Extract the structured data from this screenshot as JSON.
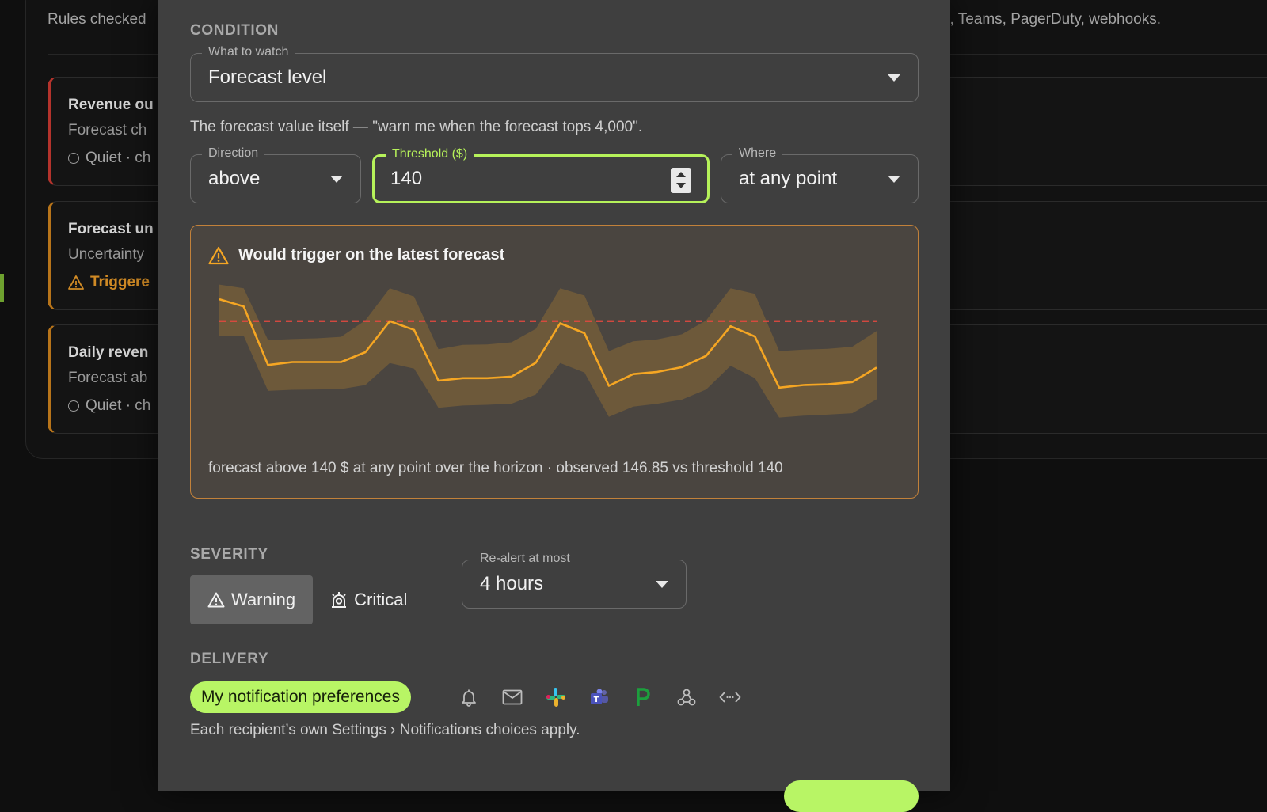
{
  "background": {
    "intro_left": "Rules checked",
    "intro_right": "k, Teams, PagerDuty, webhooks.",
    "rules": [
      {
        "title": "Revenue ou",
        "subtitle": "Forecast ch",
        "status": "Quiet · ch",
        "state": "quiet",
        "accent": "#b4332c"
      },
      {
        "title": "Forecast un",
        "subtitle": "Uncertainty",
        "status": "Triggere",
        "state": "triggered",
        "accent": "#b7741a"
      },
      {
        "title": "Daily reven",
        "subtitle": "Forecast ab",
        "status": "Quiet · ch",
        "state": "quiet",
        "accent": "#b7741a"
      }
    ]
  },
  "modal": {
    "condition": {
      "section_label": "CONDITION",
      "watch": {
        "label": "What to watch",
        "value": "Forecast level"
      },
      "helper": "The forecast value itself — \"warn me when the forecast tops 4,000\".",
      "direction": {
        "label": "Direction",
        "value": "above"
      },
      "threshold": {
        "label": "Threshold ($)",
        "value": "140"
      },
      "where": {
        "label": "Where",
        "value": "at any point"
      }
    },
    "preview": {
      "title": "Would trigger on the latest forecast",
      "caption": "forecast above 140 $ at any point over the horizon · observed 146.85 vs threshold 140"
    },
    "severity": {
      "section_label": "SEVERITY",
      "options": [
        {
          "label": "Warning",
          "icon": "warning-triangle-icon",
          "selected": true
        },
        {
          "label": "Critical",
          "icon": "critical-alarm-icon",
          "selected": false
        }
      ],
      "realert": {
        "label": "Re-alert at most",
        "value": "4 hours"
      }
    },
    "delivery": {
      "section_label": "DELIVERY",
      "pill_label": "My notification preferences",
      "channels": [
        "bell-icon",
        "email-icon",
        "slack-icon",
        "teams-icon",
        "pagerduty-icon",
        "webhook-icon",
        "code-icon"
      ],
      "helper": "Each recipient’s own Settings › Notifications choices apply."
    }
  },
  "colors": {
    "accent_green": "#b8f565",
    "forecast_line": "#f5a623",
    "threshold_line": "#e5483f",
    "band": "#8a6a34"
  },
  "chart_data": {
    "type": "line",
    "threshold": 140,
    "ylim": [
      112,
      151
    ],
    "median": [
      146,
      144,
      128,
      128.8,
      128.8,
      128.8,
      131.5,
      140,
      137.6,
      123.7,
      124.4,
      124.4,
      124.8,
      128.6,
      139.4,
      136.7,
      122.3,
      125.5,
      126.1,
      127.4,
      130.5,
      138.6,
      135.8,
      121.8,
      122.5,
      122.7,
      123.3,
      127.3
    ],
    "upper": [
      150,
      149,
      134.8,
      135.1,
      135.3,
      135.7,
      140.2,
      149,
      146.7,
      132.3,
      133.5,
      133.6,
      134.2,
      137.9,
      149,
      147,
      131.8,
      134.5,
      135,
      136.4,
      140.2,
      149,
      147.5,
      131.8,
      132.2,
      132.4,
      133,
      137.3
    ],
    "lower": [
      136,
      136,
      120.9,
      121.2,
      121.3,
      121.4,
      122.5,
      128.5,
      127,
      116.3,
      116.9,
      117.1,
      117.4,
      119.9,
      128.5,
      125.9,
      113.8,
      116.6,
      117.4,
      118.5,
      121.3,
      127.8,
      124.4,
      113.6,
      114.1,
      114.4,
      114.8,
      118.6
    ]
  }
}
